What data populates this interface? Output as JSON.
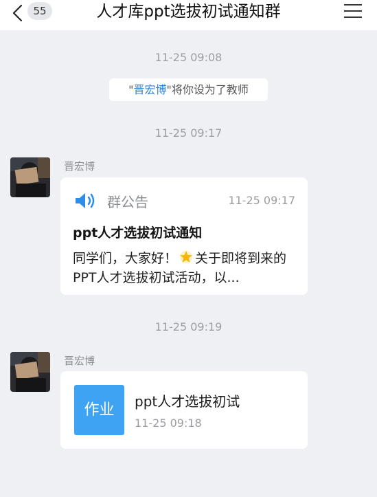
{
  "header": {
    "back_icon": "chevron-left-icon",
    "unread_count": "55",
    "title": "人才库ppt选拔初试通知群",
    "menu_icon": "hamburger-menu-icon"
  },
  "messages": {
    "time1": "11-25 09:08",
    "system": {
      "quote_open": "\"",
      "name": "晋宏博",
      "quote_close": "\"",
      "text": "将你设为了教师"
    },
    "time2": "11-25 09:17",
    "announcement": {
      "sender": "晋宏博",
      "icon": "speaker-icon",
      "label": "群公告",
      "time": "11-25 09:17",
      "title": "ppt人才选拔初试通知",
      "body_part1": "同学们，大家好！",
      "emoji": "star-emoji-icon",
      "body_part2": "关于即将到来的PPT人才选拔初试活动，以..."
    },
    "time3": "11-25 09:19",
    "homework": {
      "sender": "晋宏博",
      "tile_label": "作业",
      "title": "ppt人才选拔初试",
      "time": "11-25 09:18"
    }
  },
  "colors": {
    "background": "#eef0f3",
    "accent_blue": "#3183d6",
    "homework_tile": "#3fa3f3"
  }
}
